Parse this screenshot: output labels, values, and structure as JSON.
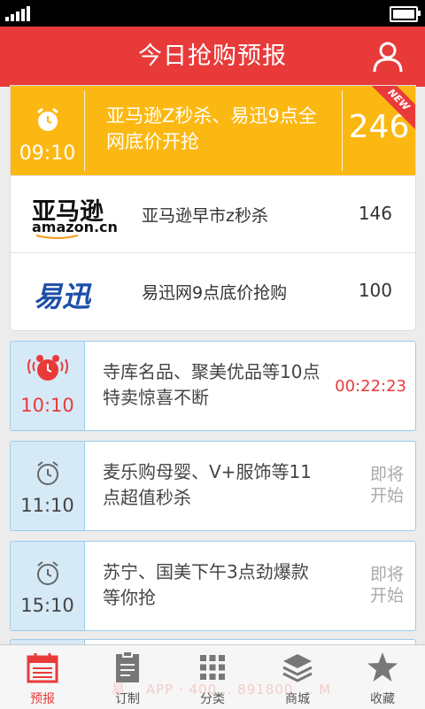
{
  "header": {
    "title": "今日抢购预报"
  },
  "hero": {
    "time": "09:10",
    "text": "亚马逊Z秒杀、易迅9点全网底价开抢",
    "count": "246",
    "badge": "NEW"
  },
  "sub_items": [
    {
      "logo": "亚马逊",
      "logo_sub": "amazon.cn",
      "name": "亚马逊早市z秒杀",
      "count": "146"
    },
    {
      "logo": "易迅",
      "name": "易迅网9点底价抢购",
      "count": "100"
    }
  ],
  "cards": [
    {
      "time": "10:10",
      "text": "寺库名品、聚美优品等10点特卖惊喜不断",
      "countdown": "00:22:23",
      "status": "ringing"
    },
    {
      "time": "11:10",
      "text": "麦乐购母婴、V+服饰等11点超值秒杀",
      "soon": "即将开始"
    },
    {
      "time": "15:10",
      "text": "苏宁、国美下午3点劲爆款等你抢",
      "soon": "即将开始"
    }
  ],
  "tabs": [
    {
      "label": "预报",
      "icon": "calendar-icon",
      "active": true
    },
    {
      "label": "订制",
      "icon": "clipboard-icon"
    },
    {
      "label": "分类",
      "icon": "grid-icon"
    },
    {
      "label": "商城",
      "icon": "layers-icon"
    },
    {
      "label": "收藏",
      "icon": "star-icon"
    }
  ],
  "watermark": "易... APP · 400... 891800 ... M",
  "colors": {
    "brand": "#e93a3a",
    "hero": "#fcb812",
    "card_left": "#d5e9f7",
    "card_border": "#9ecbea"
  }
}
